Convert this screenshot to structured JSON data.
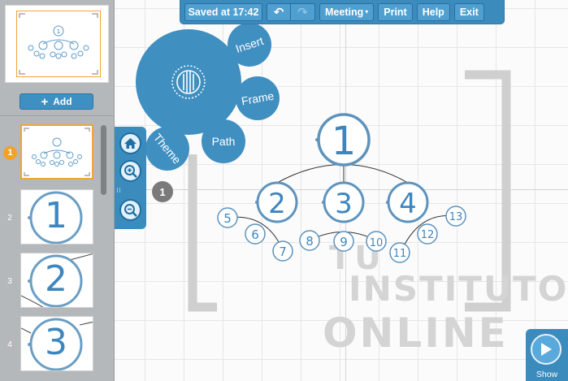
{
  "toolbar": {
    "saved_label": "Saved at 17:42",
    "undo_icon": "undo-icon",
    "redo_icon": "redo-icon",
    "meeting_label": "Meeting",
    "print_label": "Print",
    "help_label": "Help",
    "exit_label": "Exit"
  },
  "sidebar": {
    "add_label": "Add",
    "slides": [
      {
        "number": "1",
        "content": "",
        "active": true
      },
      {
        "number": "2",
        "content": "1"
      },
      {
        "number": "3",
        "content": "2"
      },
      {
        "number": "4",
        "content": "3"
      }
    ]
  },
  "bubble_menu": {
    "insert_label": "Insert",
    "frame_label": "Frame",
    "path_label": "Path",
    "theme_label": "Theme"
  },
  "zoom": {
    "home_icon": "home-icon",
    "zoom_in_icon": "zoom-in-icon",
    "zoom_out_icon": "zoom-out-icon"
  },
  "path_badge": "1",
  "diagram": {
    "root": "1",
    "level1": [
      "2",
      "3",
      "4"
    ],
    "level2": [
      "5",
      "6",
      "7",
      "8",
      "9",
      "10",
      "11",
      "12",
      "13"
    ]
  },
  "show_label": "Show",
  "watermark": {
    "line1": "TU",
    "line2": "INSTITUTO",
    "line3": "ONLINE"
  },
  "colors": {
    "accent": "#3c8bbd",
    "active": "#f2a33a",
    "sidebar": "#b5b8ba"
  }
}
